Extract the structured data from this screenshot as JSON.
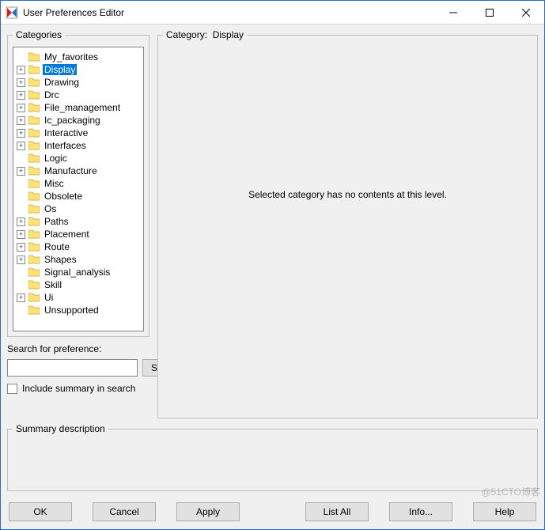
{
  "window": {
    "title": "User Preferences Editor",
    "min": "Minimize",
    "max": "Maximize",
    "close": "Close"
  },
  "left": {
    "categories_label": "Categories",
    "search_label": "Search for preference:",
    "search_value": "",
    "search_button": "Search",
    "include_summary_label": "Include summary in search"
  },
  "tree": [
    {
      "label": "My_favorites",
      "expandable": false,
      "selected": false
    },
    {
      "label": "Display",
      "expandable": true,
      "selected": true
    },
    {
      "label": "Drawing",
      "expandable": true,
      "selected": false
    },
    {
      "label": "Drc",
      "expandable": true,
      "selected": false
    },
    {
      "label": "File_management",
      "expandable": true,
      "selected": false
    },
    {
      "label": "Ic_packaging",
      "expandable": true,
      "selected": false
    },
    {
      "label": "Interactive",
      "expandable": true,
      "selected": false
    },
    {
      "label": "Interfaces",
      "expandable": true,
      "selected": false
    },
    {
      "label": "Logic",
      "expandable": false,
      "selected": false
    },
    {
      "label": "Manufacture",
      "expandable": true,
      "selected": false
    },
    {
      "label": "Misc",
      "expandable": false,
      "selected": false
    },
    {
      "label": "Obsolete",
      "expandable": false,
      "selected": false
    },
    {
      "label": "Os",
      "expandable": false,
      "selected": false
    },
    {
      "label": "Paths",
      "expandable": true,
      "selected": false
    },
    {
      "label": "Placement",
      "expandable": true,
      "selected": false
    },
    {
      "label": "Route",
      "expandable": true,
      "selected": false
    },
    {
      "label": "Shapes",
      "expandable": true,
      "selected": false
    },
    {
      "label": "Signal_analysis",
      "expandable": false,
      "selected": false
    },
    {
      "label": "Skill",
      "expandable": false,
      "selected": false
    },
    {
      "label": "Ui",
      "expandable": true,
      "selected": false
    },
    {
      "label": "Unsupported",
      "expandable": false,
      "selected": false
    }
  ],
  "right": {
    "category_prefix": "Category:",
    "category_name": "Display",
    "empty_message": "Selected category has no contents at this level."
  },
  "summary": {
    "label": "Summary description",
    "text": ""
  },
  "buttons": {
    "ok": "OK",
    "cancel": "Cancel",
    "apply": "Apply",
    "list_all": "List All",
    "info": "Info...",
    "help": "Help"
  },
  "watermark": "@51CTO博客"
}
